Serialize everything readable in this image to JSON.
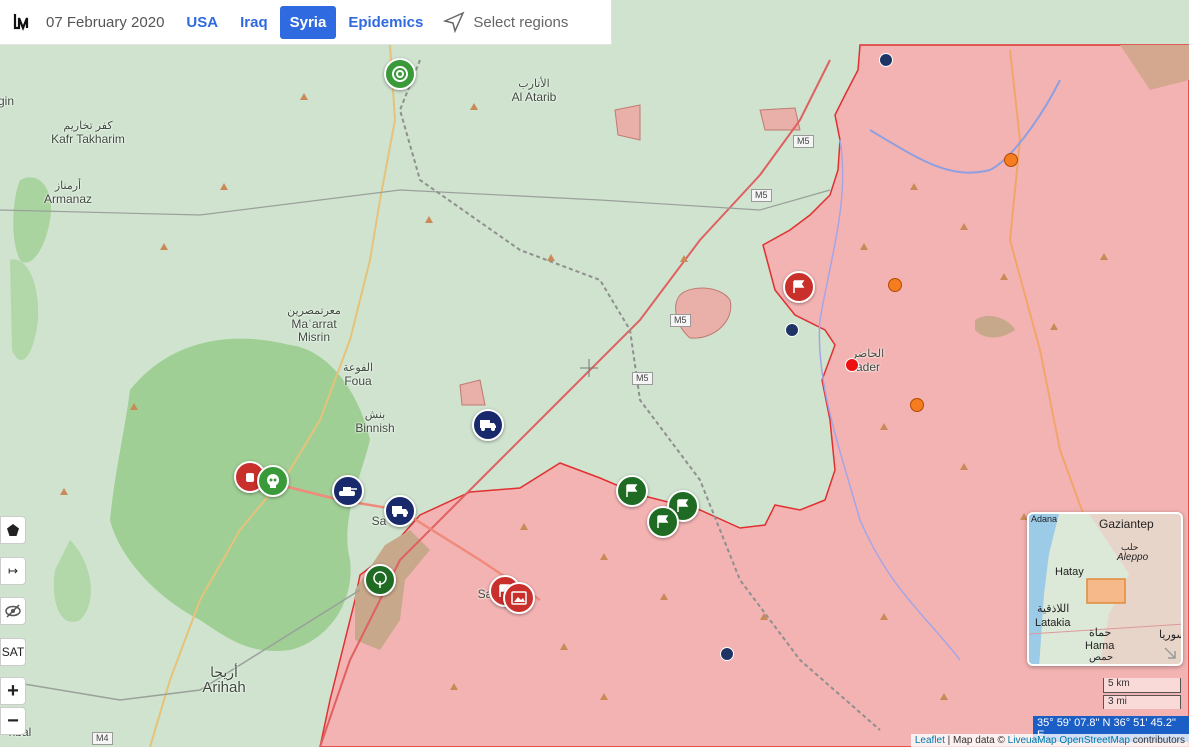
{
  "header": {
    "date": "07 February 2020",
    "links": [
      "USA",
      "Iraq",
      "Syria",
      "Epidemics"
    ],
    "active_link": "Syria",
    "select_regions": "Select regions"
  },
  "places": {
    "al_atarib": {
      "ar": "الأتارب",
      "en": "Al Atarib"
    },
    "kafr_takharim": {
      "ar": "كفر تخاريم",
      "en": "Kafr Takharim"
    },
    "armanaz": {
      "ar": "أرمناز",
      "en": "Armanaz"
    },
    "maarrat_misrin": {
      "ar": "معرتمصرين",
      "en1": "Maʿarrat",
      "en2": "Misrin"
    },
    "foua": {
      "ar": "الفوعة",
      "en": "Foua"
    },
    "binnish": {
      "ar": "بنش",
      "en": "Binnish"
    },
    "arihah": {
      "ar": "أريحا",
      "en": "Arihah"
    },
    "hader": {
      "ar": "الحاضر",
      "en": "ader"
    },
    "saraqib_partial": "Sa",
    "left_edge_1": "gin",
    "left_edge_2": "nbal"
  },
  "roads": {
    "m5": "M5",
    "m4": "M4"
  },
  "controls": {
    "polygon_icon": "pentagon-icon",
    "arrow_label": "↦",
    "hide_label": "eye-slash-icon",
    "sat_label": "SAT",
    "zoom_in": "+",
    "zoom_out": "−"
  },
  "minimap": {
    "gaziantep": "Gaziantep",
    "hatay": "Hatay",
    "aleppo_ar": "حلب",
    "aleppo_en": "Aleppo",
    "latakia_ar": "اللاذقية",
    "latakia_en": "Latakia",
    "hama_ar": "حماة",
    "hama_en": "Hama",
    "homs_ar": "حمص",
    "homs_en": "Homs",
    "syria_ar": "سوريا",
    "adana": "Adana"
  },
  "scale": {
    "km": "5 km",
    "mi": "3 mi"
  },
  "coords": "35° 59' 07.8\" N 36° 51' 45.2\" E",
  "attribution": {
    "leaflet": "Leaflet",
    "sep1": " | Map data © ",
    "livemap": "LiveuaMap",
    "osm": "OpenStreetMap",
    "contrib": " contributors"
  },
  "colors": {
    "rebel_green": "#cfe3cf",
    "government_red": "#f4b3b3",
    "front_line": "#e03030",
    "accent": "#2f6ae0"
  }
}
